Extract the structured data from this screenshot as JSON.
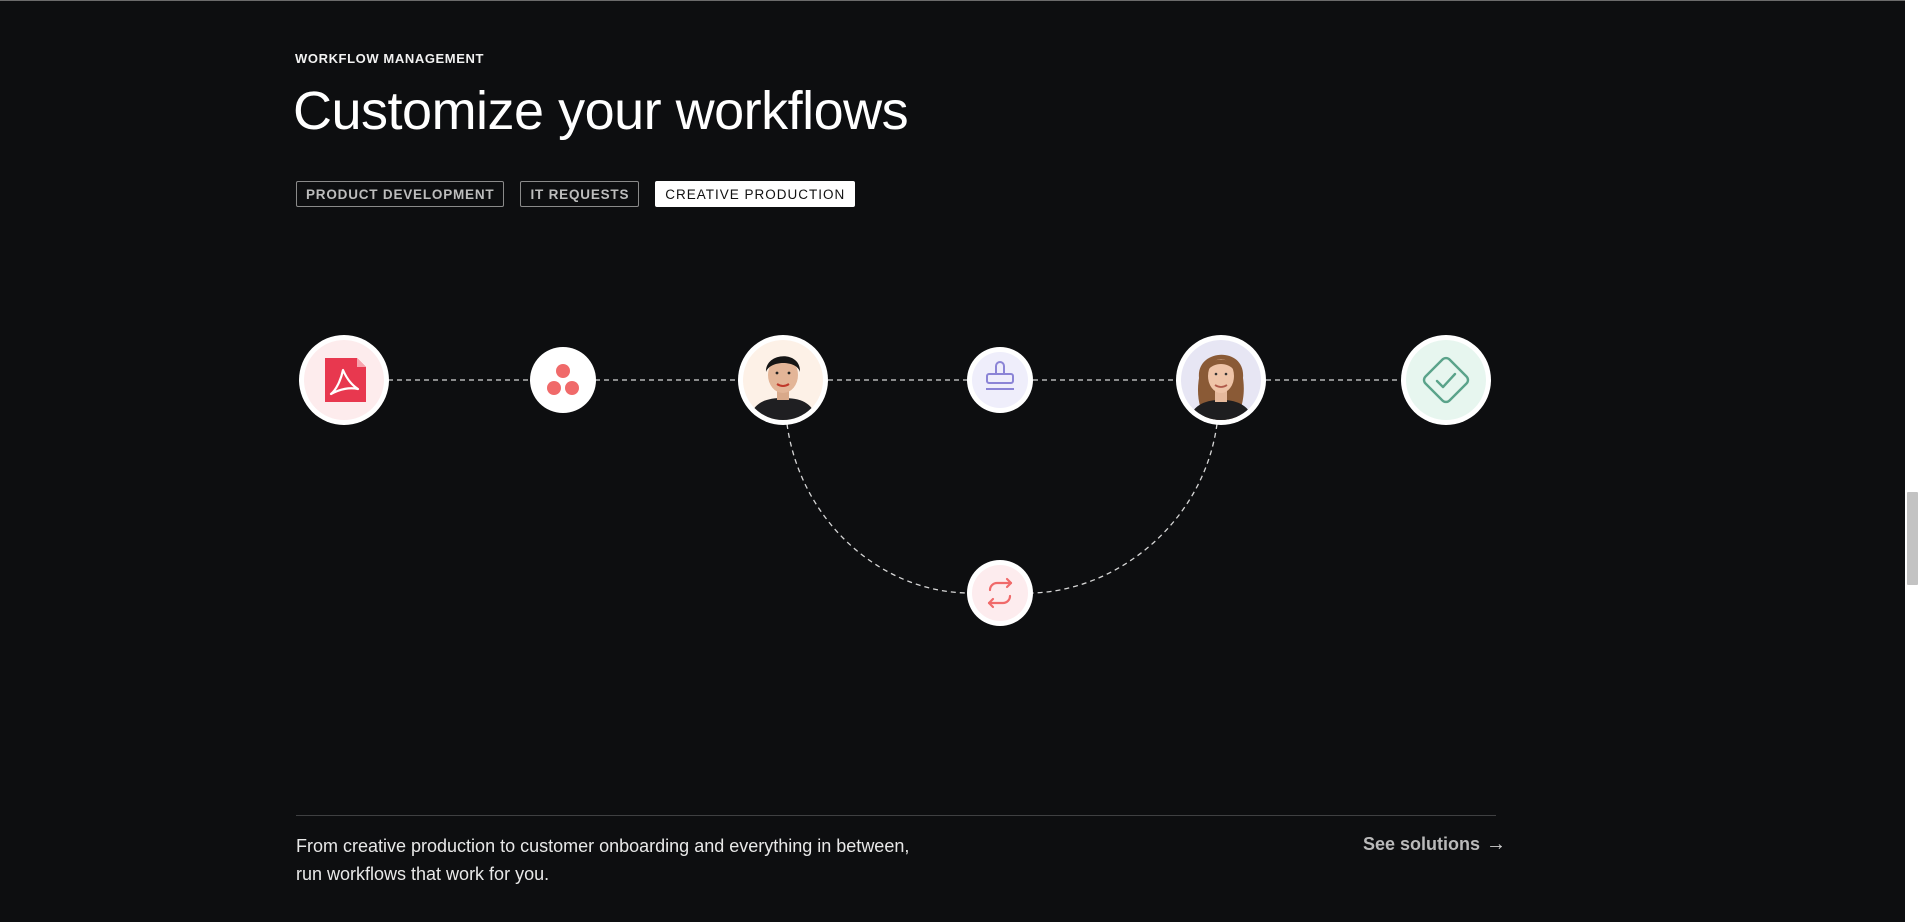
{
  "section": {
    "eyebrow": "WORKFLOW MANAGEMENT",
    "title": "Customize your workflows"
  },
  "tabs": [
    {
      "label": "PRODUCT DEVELOPMENT",
      "active": false
    },
    {
      "label": "IT REQUESTS",
      "active": false
    },
    {
      "label": "CREATIVE PRODUCTION",
      "active": true
    }
  ],
  "workflow_nodes": [
    {
      "name": "pdf-file-icon",
      "kind": "icon"
    },
    {
      "name": "asana-logo-icon",
      "kind": "icon"
    },
    {
      "name": "reviewer-avatar-1",
      "kind": "avatar"
    },
    {
      "name": "approval-stamp-icon",
      "kind": "icon"
    },
    {
      "name": "reviewer-avatar-2",
      "kind": "avatar"
    },
    {
      "name": "approved-check-icon",
      "kind": "icon"
    },
    {
      "name": "revision-loop-icon",
      "kind": "icon"
    }
  ],
  "footer": {
    "line1": "From creative production to customer onboarding and everything in between,",
    "line2": "run workflows that work for you.",
    "link_label": "See solutions",
    "link_arrow": "→"
  },
  "colors": {
    "background": "#0d0e10",
    "pdf_red": "#e8384f",
    "asana_coral": "#f06a6a",
    "stamp_purple": "#8b84d6",
    "check_green": "#5aa38a"
  }
}
